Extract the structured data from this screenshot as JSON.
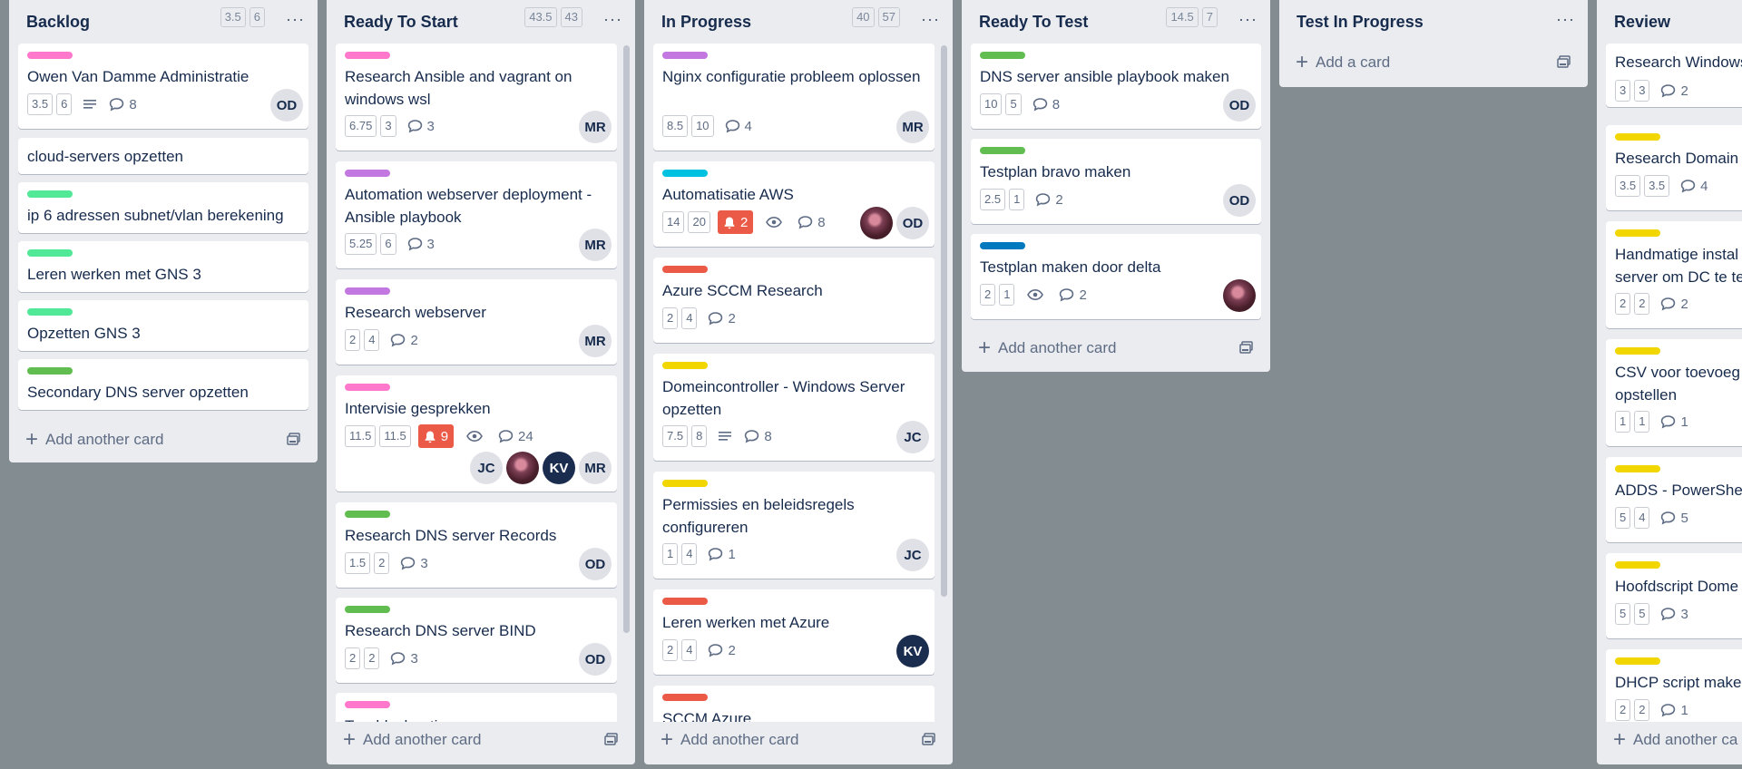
{
  "colors": {
    "pink": "#ff78cb",
    "purple": "#c377e0",
    "green": "#61bd4f",
    "lime": "#51e898",
    "sky": "#00c2e0",
    "red": "#eb5a46",
    "yellow": "#f2d600",
    "blue": "#0079bf"
  },
  "lists": {
    "backlog": {
      "title": "Backlog",
      "points": [
        "3.5",
        "6"
      ],
      "cards": [
        {
          "title": "Owen Van Damme Administratie",
          "label": "pink",
          "p1": "3.5",
          "p2": "6",
          "comments": "8",
          "avatar": "OD"
        },
        {
          "title": "cloud-servers opzetten"
        },
        {
          "title": "ip 6 adressen subnet/vlan berekening",
          "label": "lime"
        },
        {
          "title": "Leren werken met GNS 3",
          "label": "lime"
        },
        {
          "title": "Opzetten GNS 3",
          "label": "lime"
        },
        {
          "title": "Secondary DNS server opzetten",
          "label": "green"
        }
      ],
      "add_label": "Add another card"
    },
    "ready": {
      "title": "Ready To Start",
      "points": [
        "43.5",
        "43"
      ],
      "cards": [
        {
          "title": "Research Ansible and vagrant on windows wsl",
          "label": "pink",
          "p1": "6.75",
          "p2": "3",
          "comments": "3",
          "avatar": "MR"
        },
        {
          "title": "Automation webserver deployment - Ansible playbook",
          "label": "purple",
          "p1": "5.25",
          "p2": "6",
          "comments": "3",
          "avatar": "MR"
        },
        {
          "title": "Research webserver",
          "label": "purple",
          "p1": "2",
          "p2": "4",
          "comments": "2",
          "avatar": "MR"
        },
        {
          "title": "Intervisie gesprekken",
          "label": "pink",
          "p1": "11.5",
          "p2": "11.5",
          "alerts": "9",
          "comments": "24",
          "avatars": [
            "JC",
            "KV",
            "MR"
          ]
        },
        {
          "title": "Research DNS server Records",
          "label": "green",
          "p1": "1.5",
          "p2": "2",
          "comments": "3",
          "avatar": "OD"
        },
        {
          "title": "Research DNS server BIND",
          "label": "green",
          "p1": "2",
          "p2": "2",
          "comments": "3",
          "avatar": "OD"
        },
        {
          "title": "Troubleshooting",
          "label": "pink"
        }
      ],
      "add_label": "Add another card"
    },
    "progress": {
      "title": "In Progress",
      "points": [
        "40",
        "57"
      ],
      "cards": [
        {
          "title": "Nginx configuratie probleem oplossen",
          "label": "purple",
          "p1": "8.5",
          "p2": "10",
          "comments": "4",
          "avatar": "MR"
        },
        {
          "title": "Automatisatie AWS",
          "label": "sky",
          "p1": "14",
          "p2": "20",
          "alerts": "2",
          "comments": "8",
          "avatar": "OD"
        },
        {
          "title": "Azure SCCM Research",
          "label": "red",
          "p1": "2",
          "p2": "4",
          "comments": "2"
        },
        {
          "title": "Domeincontroller - Windows Server opzetten",
          "label": "yellow",
          "p1": "7.5",
          "p2": "8",
          "comments": "8",
          "avatar": "JC"
        },
        {
          "title": "Permissies en beleidsregels configureren",
          "label": "yellow",
          "p1": "1",
          "p2": "4",
          "comments": "1",
          "avatar": "JC"
        },
        {
          "title": "Leren werken met Azure",
          "label": "red",
          "p1": "2",
          "p2": "4",
          "comments": "2",
          "avatar": "KV"
        },
        {
          "title": "SCCM Azure",
          "label": "red"
        }
      ],
      "add_label": "Add another card"
    },
    "readytest": {
      "title": "Ready To Test",
      "points": [
        "14.5",
        "7"
      ],
      "cards": [
        {
          "title": "DNS server ansible playbook maken",
          "label": "green",
          "p1": "10",
          "p2": "5",
          "comments": "8",
          "avatar": "OD"
        },
        {
          "title": "Testplan bravo maken",
          "label": "green",
          "p1": "2.5",
          "p2": "1",
          "comments": "2",
          "avatar": "OD"
        },
        {
          "title": "Testplan maken door delta",
          "label": "blue",
          "p1": "2",
          "p2": "1",
          "comments": "2"
        }
      ],
      "add_label": "Add another card"
    },
    "testing": {
      "title": "Test In Progress",
      "add_label": "Add a card"
    },
    "review": {
      "title": "Review",
      "cards": [
        {
          "title": "Research Windows",
          "p1": "3",
          "p2": "3",
          "comments": "2"
        },
        {
          "title": "Research Domain",
          "label": "yellow",
          "p1": "3.5",
          "p2": "3.5",
          "comments": "4"
        },
        {
          "title": "Handmatige instal",
          "title2": "server om DC te te",
          "label": "yellow",
          "p1": "2",
          "p2": "2",
          "comments": "2"
        },
        {
          "title": "CSV voor toevoeg",
          "title2": "opstellen",
          "label": "yellow",
          "p1": "1",
          "p2": "1",
          "comments": "1"
        },
        {
          "title": "ADDS - PowerShel",
          "label": "yellow",
          "p1": "5",
          "p2": "4",
          "comments": "5"
        },
        {
          "title": "Hoofdscript Dome",
          "label": "yellow",
          "p1": "5",
          "p2": "5",
          "comments": "3"
        },
        {
          "title": "DHCP script make",
          "label": "yellow",
          "p1": "2",
          "p2": "2",
          "comments": "1"
        }
      ],
      "add_label": "Add another ca"
    }
  }
}
